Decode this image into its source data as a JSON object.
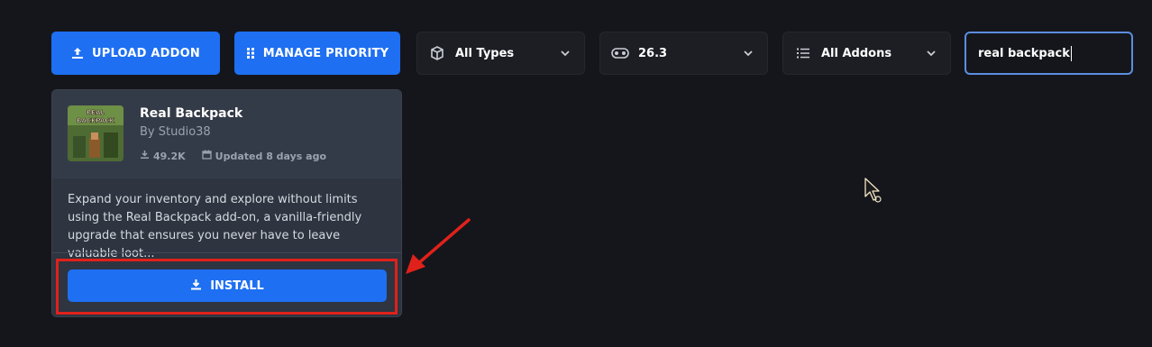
{
  "toolbar": {
    "upload_label": "UPLOAD ADDON",
    "manage_label": "MANAGE PRIORITY",
    "type_filter": "All Types",
    "version_filter": "26.3",
    "addon_filter": "All Addons",
    "search_value": "real backpack"
  },
  "card": {
    "thumb_text": "REAL BACKPACK",
    "title": "Real Backpack",
    "author": "By Studio38",
    "downloads": "49.2K",
    "updated": "Updated 8 days ago",
    "description": "Expand your inventory and explore without limits using the Real Backpack add-on, a vanilla-friendly upgrade that ensures you never have to leave valuable loot...",
    "install_label": "INSTALL"
  },
  "colors": {
    "accent": "#1e6ff2",
    "background": "#15161b",
    "highlight": "#e0211b"
  },
  "icons": {
    "upload": "upload-icon",
    "priority": "drag-grid-icon",
    "types": "box-icon",
    "version": "gamepad-icon",
    "addons": "list-icon",
    "chevron": "chevron-down-icon",
    "download": "download-icon",
    "calendar": "calendar-icon"
  }
}
